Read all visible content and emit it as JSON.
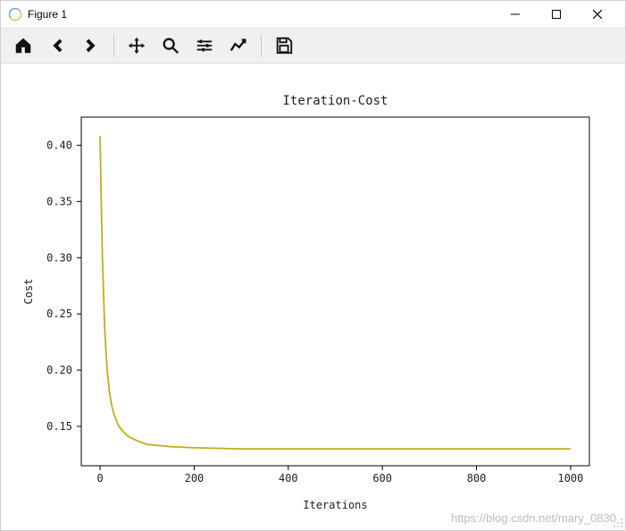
{
  "window": {
    "title": "Figure 1"
  },
  "toolbar": {
    "home_tip": "Home",
    "back_tip": "Back",
    "forward_tip": "Forward",
    "pan_tip": "Pan",
    "zoom_tip": "Zoom",
    "subplots_tip": "Configure subplots",
    "edit_tip": "Edit axis",
    "save_tip": "Save"
  },
  "watermark": "https://blog.csdn.net/mary_0830",
  "chart_data": {
    "type": "line",
    "title": "Iteration-Cost",
    "xlabel": "Iterations",
    "ylabel": "Cost",
    "xlim": [
      -40,
      1040
    ],
    "ylim": [
      0.115,
      0.425
    ],
    "xticks": [
      0,
      200,
      400,
      600,
      800,
      1000
    ],
    "yticks": [
      0.15,
      0.2,
      0.25,
      0.3,
      0.35,
      0.4
    ],
    "ytick_labels": [
      "0.15",
      "0.20",
      "0.25",
      "0.30",
      "0.35",
      "0.40"
    ],
    "series": [
      {
        "name": "cost",
        "color": "#c0ae19",
        "x": [
          0,
          2,
          5,
          8,
          10,
          15,
          20,
          25,
          30,
          40,
          50,
          60,
          80,
          100,
          150,
          200,
          300,
          400,
          600,
          800,
          1000
        ],
        "y": [
          0.408,
          0.36,
          0.3,
          0.26,
          0.235,
          0.2,
          0.18,
          0.168,
          0.16,
          0.15,
          0.145,
          0.141,
          0.137,
          0.134,
          0.132,
          0.131,
          0.13,
          0.13,
          0.13,
          0.13,
          0.13
        ]
      }
    ]
  }
}
